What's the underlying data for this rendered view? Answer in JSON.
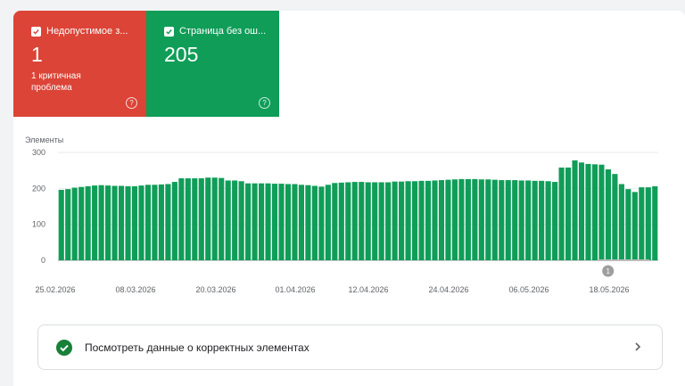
{
  "tiles": [
    {
      "label": "Недопустимое з...",
      "value": "1",
      "sub": "1 критичная проблема",
      "color": "#db4437",
      "help_icon": "?"
    },
    {
      "label": "Страница без ош...",
      "value": "205",
      "color": "#0f9d58",
      "help_icon": "?"
    }
  ],
  "chart_data": {
    "type": "bar",
    "ylabel": "Элементы",
    "yticks": [
      0,
      100,
      200,
      300
    ],
    "ylim": [
      0,
      300
    ],
    "xtick_labels": [
      "25.02.2026",
      "08.03.2026",
      "20.03.2026",
      "01.04.2026",
      "12.04.2026",
      "24.04.2026",
      "06.05.2026",
      "18.05.2026"
    ],
    "bar_color": "#0f9d58",
    "values": [
      196,
      198,
      202,
      204,
      206,
      208,
      209,
      208,
      207,
      207,
      206,
      206,
      208,
      210,
      210,
      211,
      212,
      218,
      228,
      228,
      228,
      228,
      230,
      230,
      229,
      222,
      222,
      220,
      214,
      214,
      214,
      214,
      213,
      213,
      212,
      212,
      210,
      209,
      207,
      205,
      210,
      215,
      216,
      217,
      218,
      218,
      217,
      217,
      217,
      217,
      219,
      219,
      220,
      220,
      221,
      221,
      222,
      223,
      224,
      225,
      226,
      226,
      226,
      225,
      225,
      224,
      223,
      223,
      223,
      222,
      222,
      221,
      221,
      220,
      218,
      258,
      258,
      278,
      272,
      268,
      267,
      266,
      253,
      240,
      212,
      198,
      190,
      203,
      203,
      206
    ],
    "annotation": {
      "label": "1",
      "after_index": 81
    }
  },
  "summary_row": {
    "label": "Посмотреть данные о корректных элементах",
    "icon": "check-circle-icon",
    "chevron": "chevron-right-icon"
  }
}
